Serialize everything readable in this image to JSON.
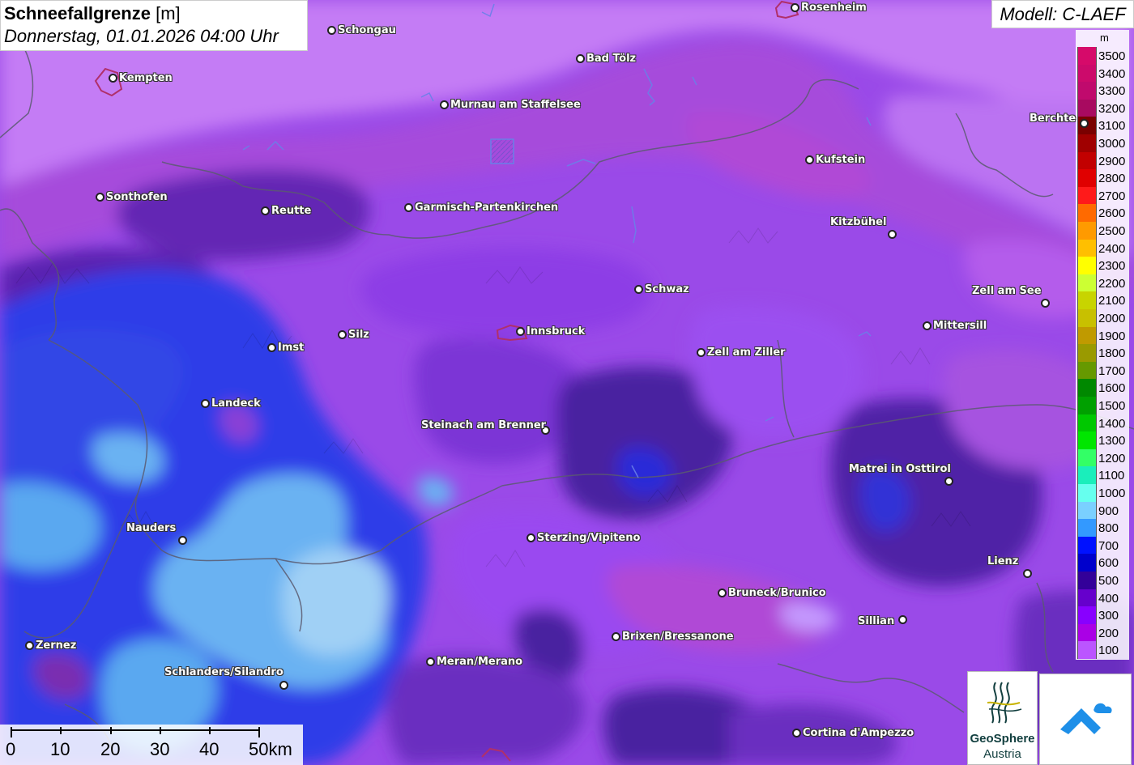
{
  "header": {
    "title": "Schneefallgrenze",
    "unit": "[m]",
    "datetime": "Donnerstag, 01.01.2026 04:00 Uhr",
    "model": "Modell: C-LAEF"
  },
  "legend": {
    "unit": "m",
    "entries": [
      {
        "label": "3500",
        "color": "#d60a6a"
      },
      {
        "label": "3400",
        "color": "#cc0a6b"
      },
      {
        "label": "3300",
        "color": "#c00a6d"
      },
      {
        "label": "3200",
        "color": "#a80a60"
      },
      {
        "label": "3100",
        "color": "#7a0000"
      },
      {
        "label": "3000",
        "color": "#a00000"
      },
      {
        "label": "2900",
        "color": "#c20000"
      },
      {
        "label": "2800",
        "color": "#e00000"
      },
      {
        "label": "2700",
        "color": "#ff1a1a"
      },
      {
        "label": "2600",
        "color": "#ff6a00"
      },
      {
        "label": "2500",
        "color": "#ff9a00"
      },
      {
        "label": "2400",
        "color": "#ffbf00"
      },
      {
        "label": "2300",
        "color": "#ffff00"
      },
      {
        "label": "2200",
        "color": "#ccff33"
      },
      {
        "label": "2100",
        "color": "#c8d400"
      },
      {
        "label": "2000",
        "color": "#c8c000"
      },
      {
        "label": "1900",
        "color": "#c09a00"
      },
      {
        "label": "1800",
        "color": "#9a9a00"
      },
      {
        "label": "1700",
        "color": "#669900"
      },
      {
        "label": "1600",
        "color": "#008800"
      },
      {
        "label": "1500",
        "color": "#00a000"
      },
      {
        "label": "1400",
        "color": "#00c800"
      },
      {
        "label": "1300",
        "color": "#00e600"
      },
      {
        "label": "1200",
        "color": "#33ff66"
      },
      {
        "label": "1100",
        "color": "#1aeebb"
      },
      {
        "label": "1000",
        "color": "#66ffee"
      },
      {
        "label": "900",
        "color": "#7ad0ff"
      },
      {
        "label": "800",
        "color": "#3399ff"
      },
      {
        "label": "700",
        "color": "#0011ff"
      },
      {
        "label": "600",
        "color": "#0000cc"
      },
      {
        "label": "500",
        "color": "#330099"
      },
      {
        "label": "400",
        "color": "#6600cc"
      },
      {
        "label": "300",
        "color": "#8800ff"
      },
      {
        "label": "200",
        "color": "#aa00e6"
      },
      {
        "label": "100",
        "color": "#bb55ff"
      }
    ]
  },
  "cities": [
    {
      "name": "Rosenheim",
      "side": "right"
    },
    {
      "name": "Schongau",
      "side": "right"
    },
    {
      "name": "Kempten",
      "side": "right"
    },
    {
      "name": "Bad Tölz",
      "side": "right"
    },
    {
      "name": "Murnau am Staffelsee",
      "side": "right"
    },
    {
      "name": "Berchte",
      "side": "left"
    },
    {
      "name": "Kufstein",
      "side": "right"
    },
    {
      "name": "Sonthofen",
      "side": "right"
    },
    {
      "name": "Reutte",
      "side": "right"
    },
    {
      "name": "Garmisch-Partenkirchen",
      "side": "right"
    },
    {
      "name": "Kitzbühel",
      "side": "left"
    },
    {
      "name": "Schwaz",
      "side": "right"
    },
    {
      "name": "Zell am See",
      "side": "left"
    },
    {
      "name": "Mittersill",
      "side": "right"
    },
    {
      "name": "Imst",
      "side": "right"
    },
    {
      "name": "Silz",
      "side": "right"
    },
    {
      "name": "Innsbruck",
      "side": "right"
    },
    {
      "name": "Zell am Ziller",
      "side": "right"
    },
    {
      "name": "Landeck",
      "side": "right"
    },
    {
      "name": "Steinach am Brenner",
      "side": "left"
    },
    {
      "name": "Matrei in Osttirol",
      "side": "left"
    },
    {
      "name": "Nauders",
      "side": "left"
    },
    {
      "name": "Sterzing/Vipiteno",
      "side": "right"
    },
    {
      "name": "Lienz",
      "side": "left"
    },
    {
      "name": "Bruneck/Brunico",
      "side": "right"
    },
    {
      "name": "Sillian",
      "side": "left"
    },
    {
      "name": "Brixen/Bressanone",
      "side": "right"
    },
    {
      "name": "Zernez",
      "side": "right"
    },
    {
      "name": "Meran/Merano",
      "side": "right"
    },
    {
      "name": "Schlanders/Silandro",
      "side": "left"
    },
    {
      "name": "Cortina d'Ampezzo",
      "side": "right"
    }
  ],
  "scale": {
    "labels": [
      "0",
      "10",
      "20",
      "30",
      "40",
      "50km"
    ]
  },
  "logos": {
    "geosphere_line1": "GeoSphere",
    "geosphere_line2": "Austria"
  }
}
